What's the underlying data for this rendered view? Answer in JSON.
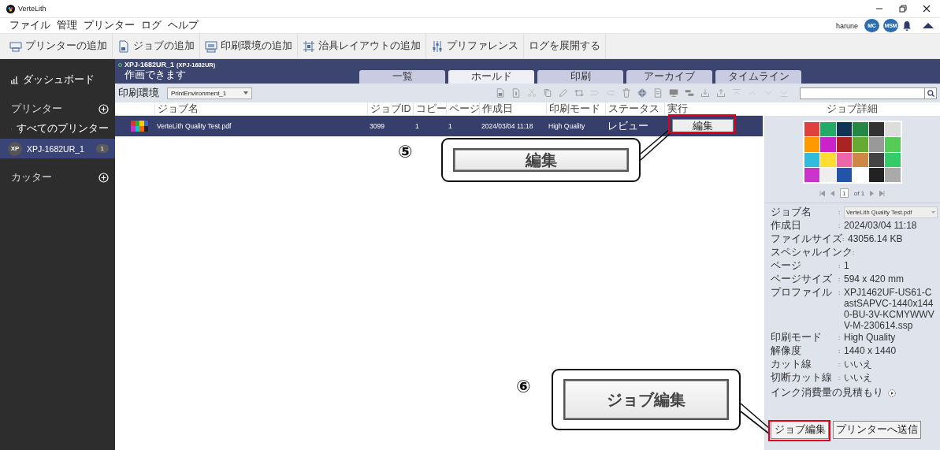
{
  "window": {
    "title": "VerteLith"
  },
  "menu": [
    "ファイル",
    "管理",
    "プリンター",
    "ログ",
    "ヘルプ"
  ],
  "user": {
    "name": "harune",
    "badges": [
      "MC",
      "MSM"
    ]
  },
  "toolbar": [
    {
      "kind": "printer",
      "label": "プリンターの追加"
    },
    {
      "kind": "job",
      "label": "ジョブの追加"
    },
    {
      "kind": "environment",
      "label": "印刷環境の追加"
    },
    {
      "kind": "layout",
      "label": "治具レイアウトの追加"
    },
    {
      "kind": "preferences",
      "label": "プリファレンス"
    },
    {
      "kind": "plain",
      "label": "ログを展開する"
    }
  ],
  "sidebar": {
    "items": [
      {
        "kind": "link",
        "label": "ダッシュボード",
        "selected": false
      },
      {
        "kind": "section",
        "label": "プリンター",
        "selected": false
      },
      {
        "kind": "link",
        "label": "すべてのプリンター",
        "selected": false
      },
      {
        "kind": "printer",
        "avatar": "XP",
        "label": "XPJ-1682UR_1",
        "count": "1",
        "selected": true
      },
      {
        "kind": "section",
        "label": "カッター",
        "selected": false
      }
    ]
  },
  "printer": {
    "name": "XPJ-1682UR_1",
    "model": "(XPJ-1682UR)",
    "status": "作画できます"
  },
  "tabs": [
    {
      "label": "一覧",
      "selected": false
    },
    {
      "label": "ホールド",
      "selected": true
    },
    {
      "label": "印刷",
      "selected": false
    },
    {
      "label": "アーカイブ",
      "selected": false
    },
    {
      "label": "タイムライン",
      "selected": false
    }
  ],
  "filter": {
    "label": "印刷環境",
    "environment": "PrintEnvironment_1"
  },
  "table": {
    "columns": [
      "ジョブ名",
      "ジョブID",
      "コピー",
      "ページ",
      "作成日",
      "印刷モード",
      "ステータス",
      "実行"
    ],
    "rows": [
      {
        "name": "VerteLith Quality Test.pdf",
        "job_id": "3099",
        "copies": "1",
        "pages": "1",
        "created": "2024/03/04 11:18",
        "print_mode": "High Quality",
        "status": "レビュー",
        "action": "編集",
        "selected": true
      }
    ]
  },
  "details": {
    "title": "ジョブ詳細",
    "pager": {
      "page": "1",
      "of": "of 1"
    },
    "separator": ":",
    "fields": [
      {
        "label": "ジョブ名",
        "value": "VerteLith Quality Test.pdf",
        "kind": "select"
      },
      {
        "label": "作成日",
        "value": "2024/03/04 11:18",
        "kind": "text"
      },
      {
        "label": "ファイルサイズ",
        "value": "43056.14 KB",
        "kind": "text"
      },
      {
        "label": "スペシャルインク",
        "kind": "text"
      },
      {
        "label": "ページ",
        "value": "1",
        "kind": "text"
      },
      {
        "label": "ページサイズ",
        "value": "594 x 420 mm",
        "kind": "text"
      },
      {
        "label": "プロファイル",
        "value": "XPJ1462UF-US61-CastSAPVC-1440x1440-BU-3V-KCMYWWVV-M-230614.ssp",
        "kind": "text"
      },
      {
        "label": "印刷モード",
        "value": "High Quality",
        "kind": "text"
      },
      {
        "label": "解像度",
        "value": "1440 x 1440",
        "kind": "text"
      },
      {
        "label": "カット線",
        "value": "いいえ",
        "kind": "text"
      },
      {
        "label": "切断カット線",
        "value": "いいえ",
        "kind": "text"
      }
    ],
    "ink_estimate": "インク消費量の見積もり",
    "buttons": [
      "ジョブ編集",
      "プリンターへ送信"
    ]
  },
  "annotations": [
    {
      "number": "⑤",
      "label": "編集"
    },
    {
      "number": "⑥",
      "label": "ジョブ編集"
    }
  ]
}
